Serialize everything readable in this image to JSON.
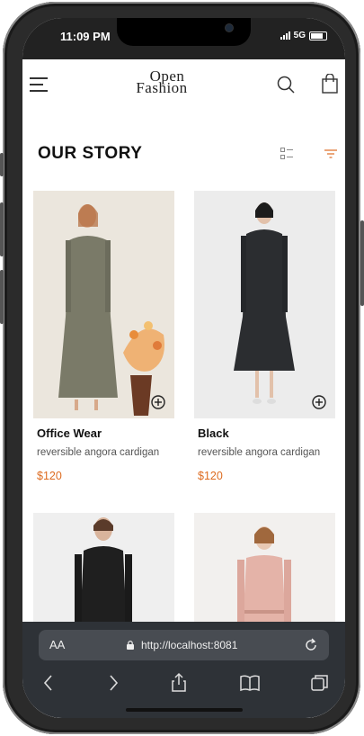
{
  "status": {
    "time": "11:09 PM",
    "network": "5G"
  },
  "header": {
    "logo_line1": "Open",
    "logo_line2": "Fashion"
  },
  "section": {
    "title": "OUR STORY"
  },
  "products": [
    {
      "name": "Office Wear",
      "description": "reversible angora cardigan",
      "price": "$120"
    },
    {
      "name": "Black",
      "description": "reversible angora cardigan",
      "price": "$120"
    },
    {
      "name": "",
      "description": "",
      "price": ""
    },
    {
      "name": "",
      "description": "",
      "price": ""
    }
  ],
  "browser": {
    "text_size_label": "AA",
    "url": "http://localhost:8081"
  },
  "colors": {
    "accent": "#dd6b20",
    "browser_bar": "#2e3237",
    "status_bar": "#222222"
  },
  "icons": [
    "menu-icon",
    "search-icon",
    "shopping-bag-icon",
    "list-view-icon",
    "filter-icon",
    "add-circle-icon",
    "lock-icon",
    "reload-icon",
    "back-icon",
    "forward-icon",
    "share-icon",
    "bookmarks-icon",
    "tabs-icon"
  ]
}
